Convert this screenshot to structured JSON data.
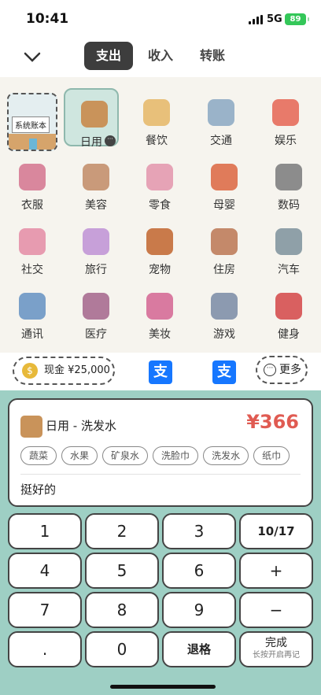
{
  "status": {
    "time": "10:41",
    "network": "5G",
    "battery": "89"
  },
  "header": {
    "tabs": [
      {
        "label": "支出",
        "active": true
      },
      {
        "label": "收入",
        "active": false
      },
      {
        "label": "转账",
        "active": false
      }
    ]
  },
  "account_book": {
    "label": "系统账本"
  },
  "categories": [
    {
      "label": "日用",
      "icon": "daily-icon",
      "selected": true
    },
    {
      "label": "餐饮",
      "icon": "food-icon"
    },
    {
      "label": "交通",
      "icon": "plane-icon"
    },
    {
      "label": "娱乐",
      "icon": "ball-icon"
    },
    {
      "label": "衣服",
      "icon": "clothes-icon"
    },
    {
      "label": "美容",
      "icon": "beauty-icon"
    },
    {
      "label": "零食",
      "icon": "snack-icon"
    },
    {
      "label": "母婴",
      "icon": "baby-icon"
    },
    {
      "label": "数码",
      "icon": "camera-icon"
    },
    {
      "label": "社交",
      "icon": "social-icon"
    },
    {
      "label": "旅行",
      "icon": "balloon-icon"
    },
    {
      "label": "宠物",
      "icon": "pet-icon"
    },
    {
      "label": "住房",
      "icon": "house-icon"
    },
    {
      "label": "汽车",
      "icon": "car-icon"
    },
    {
      "label": "通讯",
      "icon": "mail-icon"
    },
    {
      "label": "医疗",
      "icon": "medical-icon"
    },
    {
      "label": "美妆",
      "icon": "makeup-icon"
    },
    {
      "label": "游戏",
      "icon": "game-icon"
    },
    {
      "label": "健身",
      "icon": "fitness-icon"
    }
  ],
  "accounts": {
    "cash": "现金 ¥25,000",
    "alipay_icon": "支",
    "more": "更多"
  },
  "entry": {
    "title": "日用 - 洗发水",
    "amount": "¥366",
    "tags": [
      "蔬菜",
      "水果",
      "矿泉水",
      "洗脸巾",
      "洗发水",
      "纸巾"
    ],
    "note": "挺好的"
  },
  "keypad": {
    "k1": "1",
    "k2": "2",
    "k3": "3",
    "date": "10/17",
    "k4": "4",
    "k5": "5",
    "k6": "6",
    "plus": "+",
    "k7": "7",
    "k8": "8",
    "k9": "9",
    "minus": "−",
    "dot": ".",
    "k0": "0",
    "back": "退格",
    "done": "完成",
    "done_hint": "长按开启再记"
  },
  "colors": {
    "accent": "#9ecfc4",
    "amount": "#e05b52",
    "active_tab": "#3d3d3d"
  }
}
